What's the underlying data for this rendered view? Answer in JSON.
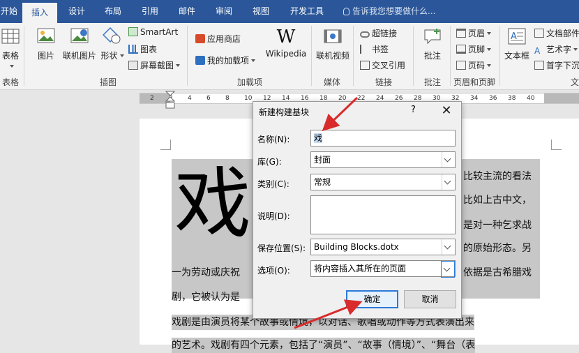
{
  "ribbon_tabs": [
    "开始",
    "插入",
    "设计",
    "布局",
    "引用",
    "邮件",
    "审阅",
    "视图",
    "开发工具"
  ],
  "tell_me": "告诉我您想要做什么...",
  "ribbon": {
    "table": {
      "label": "表格",
      "group": "表格"
    },
    "illustrations": {
      "picture": "图片",
      "online_picture": "联机图片",
      "shapes": "形状",
      "smartart": "SmartArt",
      "chart": "图表",
      "screenshot": "屏幕截图",
      "group": "插图"
    },
    "addins": {
      "store": "应用商店",
      "my_addins": "我的加载项",
      "wikipedia": "Wikipedia",
      "wiki_logo": "W",
      "group": "加载项"
    },
    "media": {
      "online_video": "联机视频",
      "group": "媒体"
    },
    "links": {
      "hyperlink": "超链接",
      "bookmark": "书签",
      "crossref": "交叉引用",
      "group": "链接"
    },
    "comments": {
      "comment": "批注",
      "group": "批注"
    },
    "header_footer": {
      "header": "页眉",
      "footer": "页脚",
      "page_number": "页码",
      "group": "页眉和页脚"
    },
    "text": {
      "textbox": "文本框",
      "doc_parts": "文档部件",
      "wordart": "艺术字",
      "dropcap": "首字下沉",
      "group": "文"
    }
  },
  "ruler_ticks": [
    "2",
    "2",
    "4",
    "6",
    "8",
    "10",
    "12",
    "14",
    "16",
    "18",
    "20",
    "22",
    "24",
    "26",
    "28",
    "30",
    "32",
    "34",
    "36",
    "38",
    "40"
  ],
  "document": {
    "big_char": "戏",
    "lines": [
      {
        "text": "比较主流的看法"
      },
      {
        "text": "比如上古中文，"
      },
      {
        "text": "是对一种乞求战"
      },
      {
        "text": "的原始形态。另"
      },
      {
        "text": "一为劳动或庆祝"
      },
      {
        "text": "依据是古希腊戏"
      },
      {
        "text": "剧，它被认为是"
      },
      {
        "text": "戏剧是由演员将某个故事或情境，以对话、歌唱或动作等方式表演出来"
      },
      {
        "text": "的艺术。戏剧有四个元素，包括了“演员”、“故事（情境）”、“舞台（表"
      }
    ]
  },
  "dialog": {
    "title": "新建构建基块",
    "help": "?",
    "close": "✕",
    "name_label": "名称(N):",
    "name_value": "戏",
    "gallery_label": "库(G):",
    "gallery_value": "封面",
    "category_label": "类别(C):",
    "category_value": "常规",
    "description_label": "说明(D):",
    "description_value": "",
    "save_label": "保存位置(S):",
    "save_value": "Building Blocks.dotx",
    "options_label": "选项(O):",
    "options_value": "将内容插入其所在的页面",
    "ok": "确定",
    "cancel": "取消"
  },
  "colors": {
    "accent": "#2b579a",
    "arrow": "#d92b2b"
  }
}
